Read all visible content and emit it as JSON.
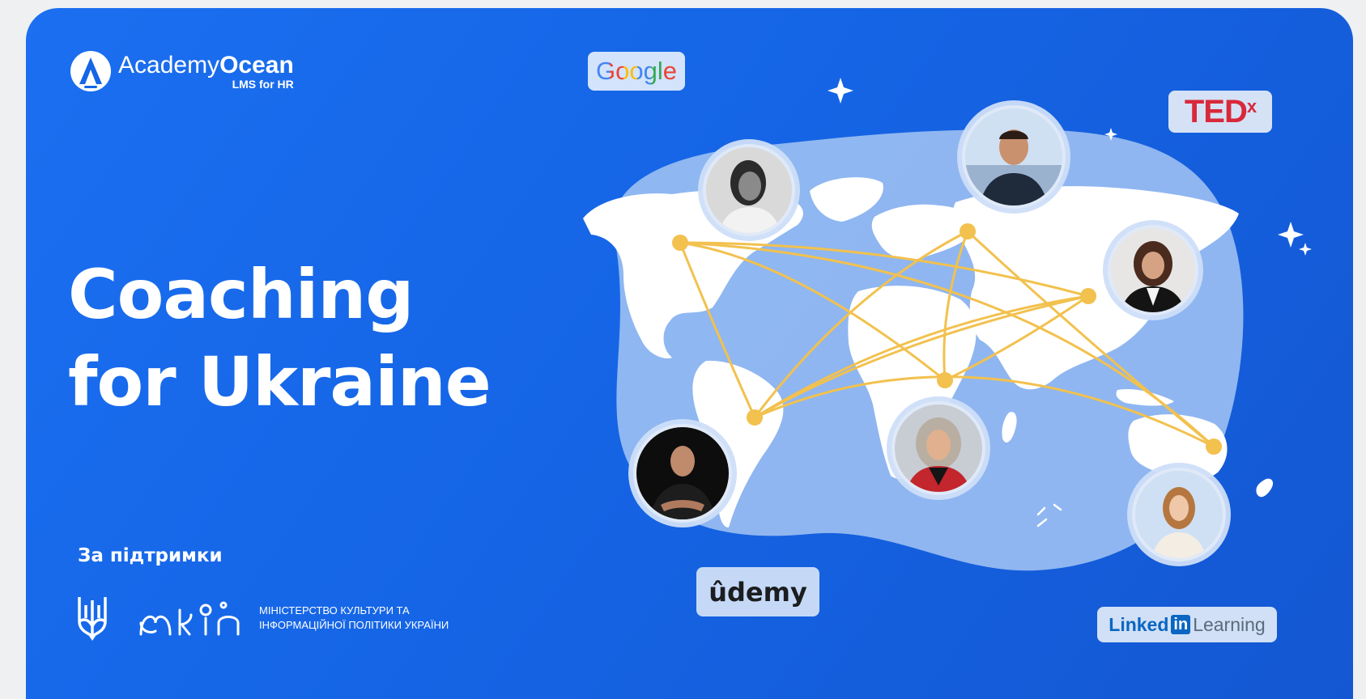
{
  "logo": {
    "academy": "Academy",
    "ocean": "Ocean",
    "tagline": "LMS for HR"
  },
  "title": {
    "line1": "Coaching",
    "line2": "for Ukraine"
  },
  "support": {
    "label": "За підтримки",
    "ministry_line1": "Міністерство культури та",
    "ministry_line2": "інформаційної політики України"
  },
  "brands": {
    "google": "Google",
    "tedx": "TED",
    "tedx_x": "x",
    "udemy": "ûdemy",
    "linkedin_word": "Linked",
    "linkedin_in": "in",
    "linkedin_learning": "Learning"
  },
  "colors": {
    "background": "#1565e6",
    "route": "#f2c14e",
    "continents": "#ffffff",
    "map_blob": "#9ec2f2"
  },
  "icons": {
    "logo": "academyocean-logo-icon",
    "trident": "ukraine-trident-icon",
    "mkip": "mkip-logo-icon"
  }
}
